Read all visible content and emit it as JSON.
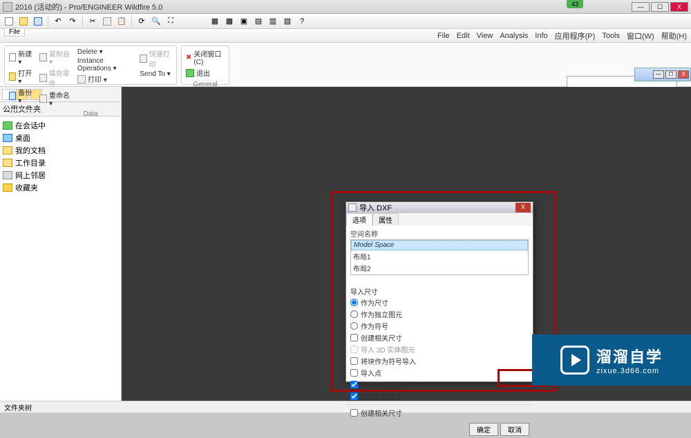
{
  "title": "2016 (活动的) - Pro/ENGINEER Wildfire 5.0",
  "badge": "43",
  "menubar": [
    "File",
    "Edit",
    "View",
    "Analysis",
    "Info",
    "应用程序(P)",
    "Tools",
    "窗口(W)",
    "帮助(H)"
  ],
  "file_tab": "File",
  "ribbon": {
    "data": {
      "new": "新建 ▾",
      "open": "打开 ▾",
      "backup": "备份 ▾",
      "copyfrom": "复制自 ▾",
      "fillparts": "填充零件",
      "rename": "重命名 ▾",
      "delete": "Delete ▾",
      "instops": "Instance Operations ▾",
      "print": "打印 ▾",
      "quickprint": "快速打印",
      "sendto": "Send To ▾",
      "label": "Data"
    },
    "general": {
      "closewin": "关闭窗口(C)",
      "exit": "退出",
      "label": "General"
    }
  },
  "sidebar": {
    "header": "公用文件夹",
    "items": [
      {
        "label": "在会话中"
      },
      {
        "label": "桌面"
      },
      {
        "label": "我的文档"
      },
      {
        "label": "工作目录"
      },
      {
        "label": "网上邻居"
      },
      {
        "label": "收藏夹"
      }
    ]
  },
  "statusbar": "文件夹树",
  "dialog": {
    "title": "导入 DXF",
    "tabs": [
      "选项",
      "属性"
    ],
    "space_label": "空间名称",
    "spaces": [
      "Model Space",
      "布局1",
      "布局2"
    ],
    "size_header": "导入尺寸",
    "radios": [
      {
        "label": "作为尺寸",
        "checked": true
      },
      {
        "label": "作为独立图元",
        "checked": false
      },
      {
        "label": "作为符号",
        "checked": false
      }
    ],
    "checks1": [
      {
        "label": "创建相关尺寸",
        "checked": false,
        "disabled": false
      },
      {
        "label": "导入 3D 实体图元",
        "checked": false,
        "disabled": true
      },
      {
        "label": "将块作为符号导入",
        "checked": false,
        "disabled": false
      },
      {
        "label": "导入点",
        "checked": false,
        "disabled": false
      },
      {
        "label": "创建可变页面大小",
        "checked": true,
        "disabled": false
      },
      {
        "label": "创建多行文本",
        "checked": true,
        "disabled": false
      }
    ],
    "checks2": [
      {
        "label": "创建相关尺寸",
        "checked": false,
        "disabled": false
      }
    ],
    "ok": "确定",
    "cancel": "取消"
  },
  "watermark": {
    "line1": "溜溜自学",
    "line2": "zixue.3d66.com"
  }
}
